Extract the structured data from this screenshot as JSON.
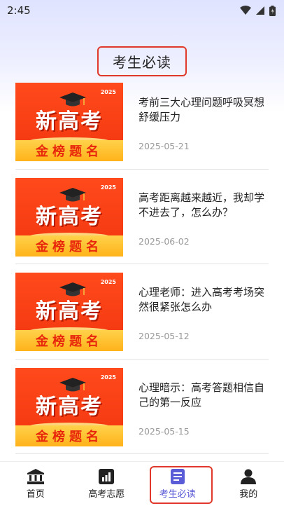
{
  "status_bar": {
    "time": "2:45",
    "icons": [
      "wifi-icon",
      "cellular-icon",
      "battery-icon"
    ]
  },
  "page": {
    "title": "考生必读"
  },
  "thumbnail": {
    "year": "2025",
    "headline": "新高考",
    "banner": "金榜题名",
    "icon": "graduation-cap-icon"
  },
  "articles": [
    {
      "title": "考前三大心理问题呼吸冥想舒缓压力",
      "date": "2025-05-21"
    },
    {
      "title": "高考距离越来越近，我却学不进去了，怎么办？",
      "date": "2025-06-02"
    },
    {
      "title": "心理老师：进入高考考场突然很紧张怎么办",
      "date": "2025-05-12"
    },
    {
      "title": "心理暗示：高考答题相信自己的第一反应",
      "date": "2025-05-15"
    }
  ],
  "bottom_nav": [
    {
      "label": "首页",
      "icon": "bank-icon",
      "active": false
    },
    {
      "label": "高考志愿",
      "icon": "bar-chart-icon",
      "active": false
    },
    {
      "label": "考生必读",
      "icon": "document-icon",
      "active": true
    },
    {
      "label": "我的",
      "icon": "person-icon",
      "active": false
    }
  ],
  "colors": {
    "accent": "#5a5bd6",
    "highlight_border": "#e0392b",
    "thumb_red": "#f2350e",
    "thumb_gold": "#ffb21a"
  }
}
